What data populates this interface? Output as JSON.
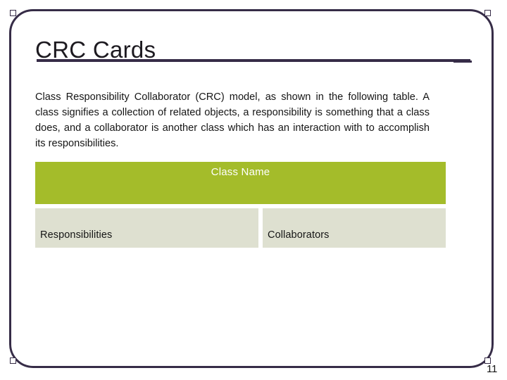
{
  "slide": {
    "title": "CRC Cards",
    "page_number": "11",
    "accent_color": "#362C47",
    "table_header_color": "#A4BC2A",
    "table_cell_color": "#DEE0D0"
  },
  "body": {
    "paragraph": "Class Responsibility Collaborator (CRC) model, as shown in the following table. A class signifies a collection of related objects, a responsibility is something that a class does, and a collaborator is another class which has an interaction with to accomplish its responsibilities."
  },
  "crc_table": {
    "header": "Class Name",
    "cells": [
      {
        "label": "Responsibilities"
      },
      {
        "label": "Collaborators"
      }
    ]
  }
}
